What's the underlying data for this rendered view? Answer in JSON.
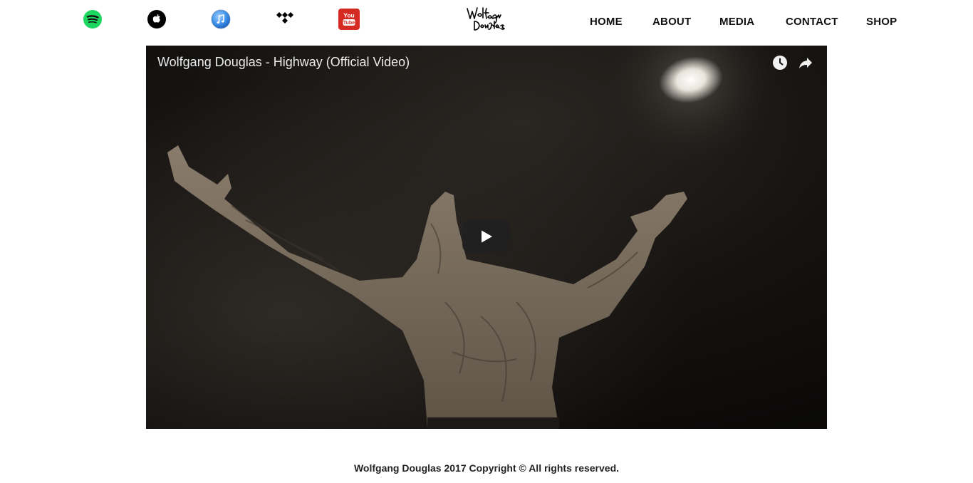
{
  "header": {
    "social_icons": [
      {
        "name": "spotify-icon",
        "color": "#1ed760"
      },
      {
        "name": "apple-music-icon",
        "color": "#000000"
      },
      {
        "name": "itunes-icon",
        "color": "#2f8ff0"
      },
      {
        "name": "tidal-icon",
        "color": "#000000"
      },
      {
        "name": "youtube-icon",
        "color": "#d42a22",
        "text_top": "You",
        "text_bottom": "Tube"
      }
    ],
    "logo": {
      "line1": "Wolf",
      "line2": "gang",
      "line3": "Douglas"
    },
    "nav": [
      "HOME",
      "ABOUT",
      "MEDIA",
      "CONTACT",
      "SHOP"
    ]
  },
  "video": {
    "title": "Wolfgang Douglas - Highway (Official Video)",
    "controls": [
      "watch-later-icon",
      "share-icon"
    ],
    "play_icon": "play-icon"
  },
  "footer": {
    "copyright": "Wolfgang Douglas 2017 Copyright © All rights reserved."
  }
}
